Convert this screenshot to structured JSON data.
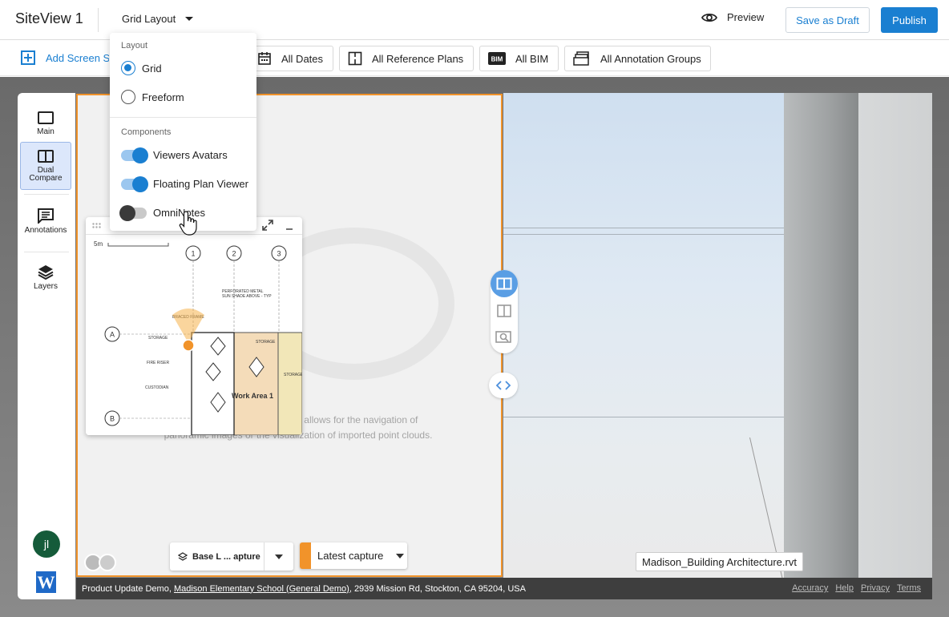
{
  "app": {
    "title": "SiteView 1"
  },
  "header": {
    "layout_trigger": "Grid Layout",
    "preview_label": "Preview",
    "draft_label": "Save as Draft",
    "publish_label": "Publish"
  },
  "toolbar": {
    "add_screen": "Add Screen Sp",
    "filters": [
      "All Dates",
      "All Reference Plans",
      "All BIM",
      "All Annotation Groups"
    ]
  },
  "layout_menu": {
    "layout_heading": "Layout",
    "layouts": [
      {
        "label": "Grid",
        "selected": true
      },
      {
        "label": "Freeform",
        "selected": false
      }
    ],
    "components_heading": "Components",
    "components": [
      {
        "label": "Viewers Avatars",
        "on": true
      },
      {
        "label": "Floating Plan Viewer",
        "on": true
      },
      {
        "label": "OmniNotes",
        "on": false
      }
    ]
  },
  "sidebar": {
    "items": [
      {
        "label_1": "Main",
        "label_2": "",
        "active": false
      },
      {
        "label_1": "Dual",
        "label_2": "Compare",
        "active": true
      },
      {
        "label_1": "Annotations",
        "label_2": "",
        "active": false
      },
      {
        "label_1": "Layers",
        "label_2": "",
        "active": false
      }
    ],
    "avatar_initials": "jl",
    "brand_letter": "W"
  },
  "viewer": {
    "message_line1": "t allows for the navigation of",
    "message_line2": "panoramic images or the visualization of imported point clouds.",
    "base_select": "Base L ... apture",
    "capture_select": "Latest capture",
    "model_label": "Madison_Building Architecture.rvt"
  },
  "plan": {
    "scale": "5m",
    "grid_cols": [
      "1",
      "2",
      "3"
    ],
    "grid_rows": [
      "A",
      "B"
    ],
    "work_area": "Work Area 1"
  },
  "footer": {
    "project": "Product Update Demo,",
    "school": "Madison Elementary School (General Demo)",
    "address": ", 2939 Mission Rd, Stockton, CA 95204, USA",
    "links": [
      "Accuracy",
      "Help",
      "Privacy",
      "Terms"
    ]
  },
  "colors": {
    "accent": "#1a7fd1",
    "capture": "#f1932a",
    "avatar": "#155b3a"
  }
}
